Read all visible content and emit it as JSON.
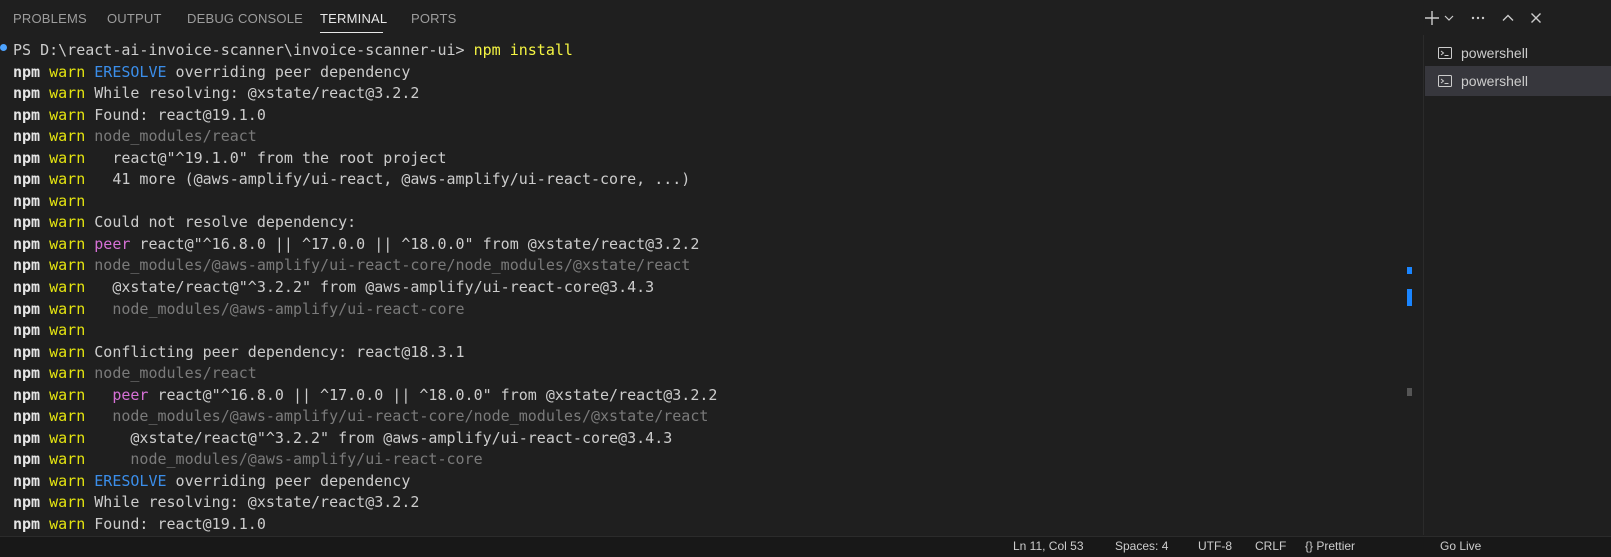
{
  "tabs": [
    {
      "label": "PROBLEMS"
    },
    {
      "label": "OUTPUT"
    },
    {
      "label": "DEBUG CONSOLE"
    },
    {
      "label": "TERMINAL"
    },
    {
      "label": "PORTS"
    }
  ],
  "active_tab": "TERMINAL",
  "toolbar": {
    "icons": [
      "plus-icon",
      "chevron-down-icon",
      "ellipsis-icon",
      "chevron-up-icon",
      "close-icon"
    ]
  },
  "terminal": {
    "prompt": "PS D:\\react-ai-invoice-scanner\\invoice-scanner-ui>",
    "command": "npm install",
    "lines": [
      [
        [
          "npm",
          "npm"
        ],
        [
          " ",
          ""
        ],
        [
          "warn",
          "warn"
        ],
        [
          " ",
          ""
        ],
        [
          "ERESOLVE",
          "blue"
        ],
        [
          " overriding peer dependency",
          "plain"
        ]
      ],
      [
        [
          "npm",
          "npm"
        ],
        [
          " ",
          ""
        ],
        [
          "warn",
          "warn"
        ],
        [
          " While resolving: @xstate/react@3.2.2",
          "plain"
        ]
      ],
      [
        [
          "npm",
          "npm"
        ],
        [
          " ",
          ""
        ],
        [
          "warn",
          "warn"
        ],
        [
          " Found: react@19.1.0",
          "plain"
        ]
      ],
      [
        [
          "npm",
          "npm"
        ],
        [
          " ",
          ""
        ],
        [
          "warn",
          "warn"
        ],
        [
          " ",
          ""
        ],
        [
          "node_modules/react",
          "gray"
        ]
      ],
      [
        [
          "npm",
          "npm"
        ],
        [
          " ",
          ""
        ],
        [
          "warn",
          "warn"
        ],
        [
          "   react@\"^19.1.0\" from the root project",
          "plain"
        ]
      ],
      [
        [
          "npm",
          "npm"
        ],
        [
          " ",
          ""
        ],
        [
          "warn",
          "warn"
        ],
        [
          "   41 more (@aws-amplify/ui-react, @aws-amplify/ui-react-core, ...)",
          "plain"
        ]
      ],
      [
        [
          "npm",
          "npm"
        ],
        [
          " ",
          ""
        ],
        [
          "warn",
          "warn"
        ]
      ],
      [
        [
          "npm",
          "npm"
        ],
        [
          " ",
          ""
        ],
        [
          "warn",
          "warn"
        ],
        [
          " Could not resolve dependency:",
          "plain"
        ]
      ],
      [
        [
          "npm",
          "npm"
        ],
        [
          " ",
          ""
        ],
        [
          "warn",
          "warn"
        ],
        [
          " ",
          ""
        ],
        [
          "peer",
          "magenta"
        ],
        [
          " react@\"^16.8.0 || ^17.0.0 || ^18.0.0\" from @xstate/react@3.2.2",
          "plain"
        ]
      ],
      [
        [
          "npm",
          "npm"
        ],
        [
          " ",
          ""
        ],
        [
          "warn",
          "warn"
        ],
        [
          " ",
          ""
        ],
        [
          "node_modules/@aws-amplify/ui-react-core/node_modules/@xstate/react",
          "gray"
        ]
      ],
      [
        [
          "npm",
          "npm"
        ],
        [
          " ",
          ""
        ],
        [
          "warn",
          "warn"
        ],
        [
          "   @xstate/react@\"^3.2.2\" from @aws-amplify/ui-react-core@3.4.3",
          "plain"
        ]
      ],
      [
        [
          "npm",
          "npm"
        ],
        [
          " ",
          ""
        ],
        [
          "warn",
          "warn"
        ],
        [
          "   ",
          ""
        ],
        [
          "node_modules/@aws-amplify/ui-react-core",
          "gray"
        ]
      ],
      [
        [
          "npm",
          "npm"
        ],
        [
          " ",
          ""
        ],
        [
          "warn",
          "warn"
        ]
      ],
      [
        [
          "npm",
          "npm"
        ],
        [
          " ",
          ""
        ],
        [
          "warn",
          "warn"
        ],
        [
          " Conflicting peer dependency: react@18.3.1",
          "plain"
        ]
      ],
      [
        [
          "npm",
          "npm"
        ],
        [
          " ",
          ""
        ],
        [
          "warn",
          "warn"
        ],
        [
          " ",
          ""
        ],
        [
          "node_modules/react",
          "gray"
        ]
      ],
      [
        [
          "npm",
          "npm"
        ],
        [
          " ",
          ""
        ],
        [
          "warn",
          "warn"
        ],
        [
          "   ",
          ""
        ],
        [
          "peer",
          "magenta"
        ],
        [
          " react@\"^16.8.0 || ^17.0.0 || ^18.0.0\" from @xstate/react@3.2.2",
          "plain"
        ]
      ],
      [
        [
          "npm",
          "npm"
        ],
        [
          " ",
          ""
        ],
        [
          "warn",
          "warn"
        ],
        [
          "   ",
          ""
        ],
        [
          "node_modules/@aws-amplify/ui-react-core/node_modules/@xstate/react",
          "gray"
        ]
      ],
      [
        [
          "npm",
          "npm"
        ],
        [
          " ",
          ""
        ],
        [
          "warn",
          "warn"
        ],
        [
          "     @xstate/react@\"^3.2.2\" from @aws-amplify/ui-react-core@3.4.3",
          "plain"
        ]
      ],
      [
        [
          "npm",
          "npm"
        ],
        [
          " ",
          ""
        ],
        [
          "warn",
          "warn"
        ],
        [
          "     ",
          ""
        ],
        [
          "node_modules/@aws-amplify/ui-react-core",
          "gray"
        ]
      ],
      [
        [
          "npm",
          "npm"
        ],
        [
          " ",
          ""
        ],
        [
          "warn",
          "warn"
        ],
        [
          " ",
          ""
        ],
        [
          "ERESOLVE",
          "blue"
        ],
        [
          " overriding peer dependency",
          "plain"
        ]
      ],
      [
        [
          "npm",
          "npm"
        ],
        [
          " ",
          ""
        ],
        [
          "warn",
          "warn"
        ],
        [
          " While resolving: @xstate/react@3.2.2",
          "plain"
        ]
      ],
      [
        [
          "npm",
          "npm"
        ],
        [
          " ",
          ""
        ],
        [
          "warn",
          "warn"
        ],
        [
          " Found: react@19.1.0",
          "plain"
        ]
      ]
    ]
  },
  "terminals_list": [
    {
      "label": "powershell",
      "icon": "terminal-icon",
      "selected": false
    },
    {
      "label": "powershell",
      "icon": "terminal-icon",
      "selected": true
    }
  ],
  "colors": {
    "background": "#1f1f1f",
    "npm": "#e5e5e5",
    "warn": "#e5e510",
    "eresolve": "#3b8eea",
    "muted": "#7a7a7a",
    "peer": "#d670d6",
    "command": "#f5f543",
    "accent": "#1a85ff"
  },
  "statusbar": {
    "items": [
      "Ln 11, Col 53",
      "Spaces: 4",
      "UTF-8",
      "CRLF",
      "{} Prettier",
      "Go Live"
    ]
  }
}
